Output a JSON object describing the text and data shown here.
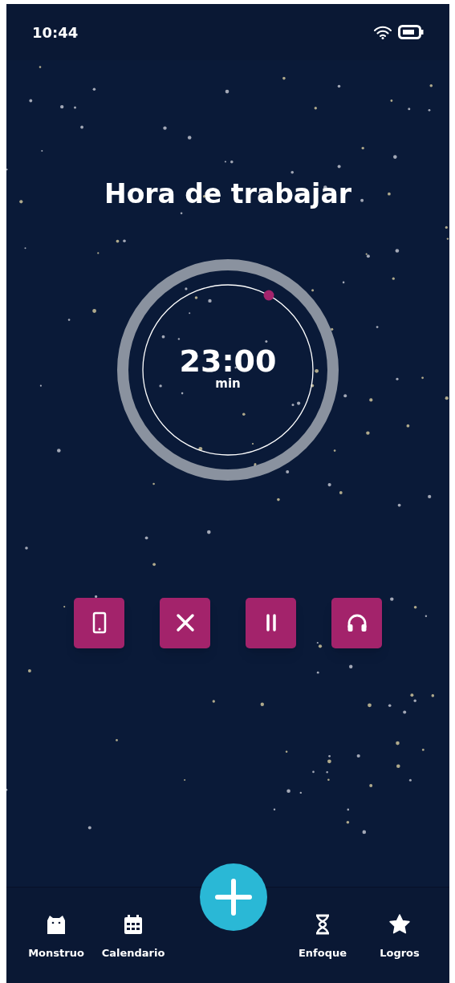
{
  "status_bar": {
    "time": "10:44"
  },
  "title": "Hora de trabajar",
  "timer": {
    "time": "23:00",
    "unit": "min"
  },
  "controls": [
    {
      "kind": "phone"
    },
    {
      "kind": "cancel"
    },
    {
      "kind": "pause"
    },
    {
      "kind": "music"
    }
  ],
  "nav": [
    {
      "label": "Monstruo",
      "kind": "monster"
    },
    {
      "label": "Calendario",
      "kind": "calendar"
    },
    {
      "kind": "add"
    },
    {
      "label": "Enfoque",
      "kind": "hourglass"
    },
    {
      "label": "Logros",
      "kind": "star"
    }
  ]
}
